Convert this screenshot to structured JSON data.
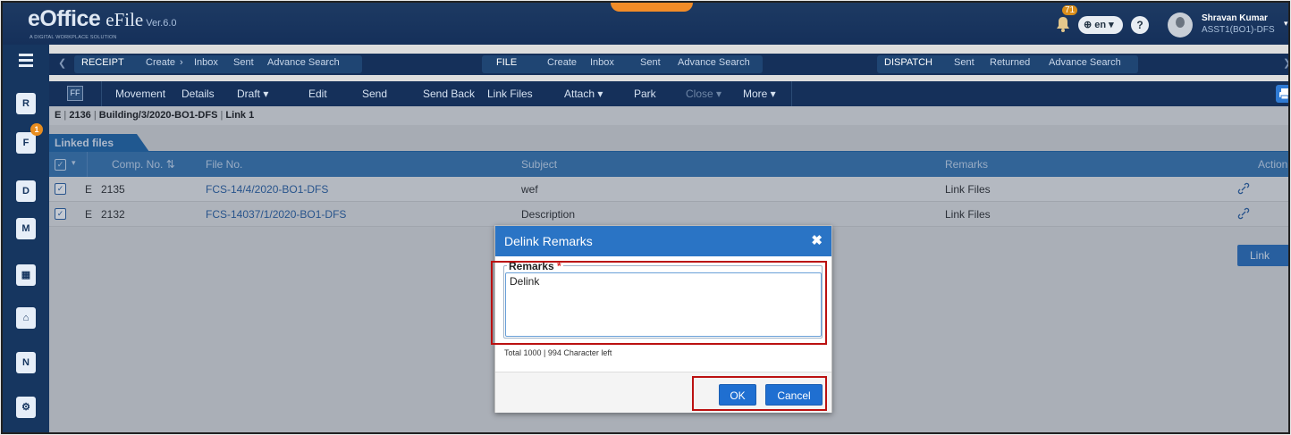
{
  "header": {
    "brand": "eOffice",
    "app": "eFile",
    "version": "Ver.6.0",
    "tagline": "A DIGITAL WORKPLACE SOLUTION",
    "notif_count": "71",
    "lang": "en",
    "user_name": "Shravan Kumar",
    "user_role": "ASST1(BO1)-DFS"
  },
  "nav": {
    "receipt": {
      "label": "RECEIPT",
      "items": [
        "Create",
        "Inbox",
        "Sent",
        "Advance Search"
      ]
    },
    "file": {
      "label": "FILE",
      "items": [
        "Create",
        "Inbox",
        "Sent",
        "Advance Search"
      ]
    },
    "dispatch": {
      "label": "DISPATCH",
      "items": [
        "Sent",
        "Returned",
        "Advance Search"
      ]
    }
  },
  "toolbar": {
    "ff": "FF",
    "movement": "Movement",
    "details": "Details",
    "draft": "Draft",
    "edit": "Edit",
    "send": "Send",
    "send_back": "Send Back",
    "link_files": "Link Files",
    "attach": "Attach",
    "park": "Park",
    "close": "Close",
    "more": "More"
  },
  "breadcrumb": {
    "prefix": "E",
    "comp_no": "2136",
    "file_no": "Building/3/2020-BO1-DFS",
    "label": "Link 1"
  },
  "section_title": "Linked files",
  "table": {
    "headers": [
      "Comp. No.",
      "File No.",
      "Subject",
      "Remarks",
      "Action"
    ],
    "rows": [
      {
        "type": "E",
        "comp_no": "2135",
        "file_no": "FCS-14/4/2020-BO1-DFS",
        "subject": "wef",
        "remarks": "Link Files"
      },
      {
        "type": "E",
        "comp_no": "2132",
        "file_no": "FCS-14037/1/2020-BO1-DFS",
        "subject": "Description",
        "remarks": "Link Files"
      }
    ]
  },
  "link_button": "Link",
  "sidebar": {
    "badge": "1"
  },
  "modal": {
    "title": "Delink Remarks",
    "field_label": "Remarks",
    "required_mark": "*",
    "value": "Delink",
    "counter": "Total 1000 | 994 Character left",
    "ok": "OK",
    "cancel": "Cancel"
  }
}
